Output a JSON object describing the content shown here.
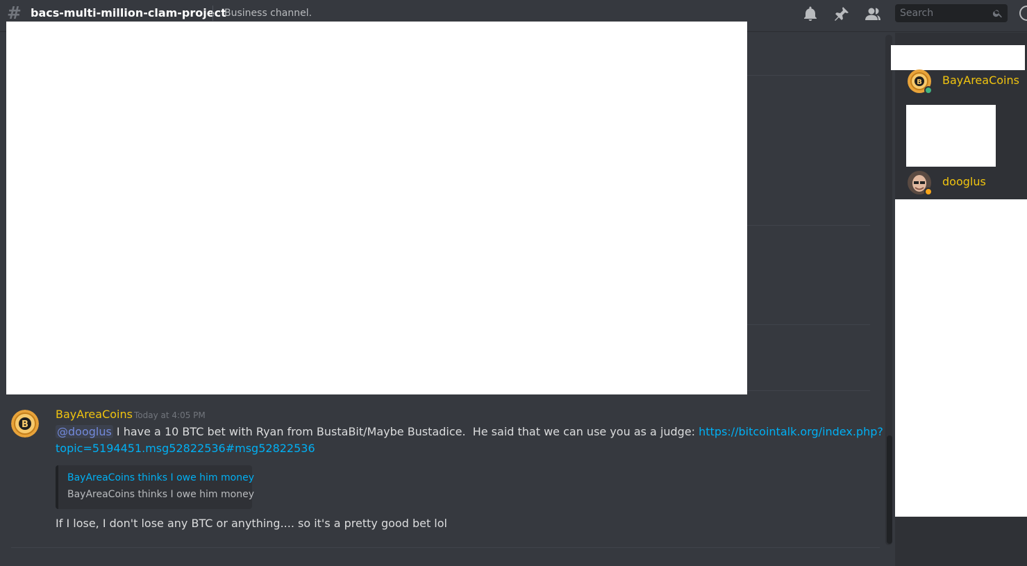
{
  "header": {
    "channel_name": "bacs-multi-million-clam-project",
    "topic": "Business channel.",
    "search_placeholder": "Search",
    "icons": [
      "hash-icon",
      "bell-icon",
      "pin-icon",
      "members-icon",
      "search-icon",
      "help-icon"
    ]
  },
  "message": {
    "author": "BayAreaCoins",
    "timestamp": "Today at 4:05 PM",
    "mention": "@dooglus",
    "text_part1": " I have a 10 BTC bet with Ryan from BustaBit/Maybe Bustadice.  He said that we can use you as a judge: ",
    "link_line1": "https://bitcointalk.org/index.php?",
    "link_line2": "topic=5194451.msg52822536#msg52822536",
    "embed": {
      "title": "BayAreaCoins thinks I owe him money",
      "description": "BayAreaCoins thinks I owe him money"
    },
    "followup": "If I lose, I don't lose any BTC or anything.... so it's a pretty good bet lol"
  },
  "members": [
    {
      "name": "BayAreaCoins",
      "status": "online",
      "status_color": "#43b581"
    },
    {
      "name": "dooglus",
      "status": "idle",
      "status_color": "#faa61a"
    }
  ],
  "colors": {
    "role_color": "#f1c40f",
    "link_color": "#00b0f4",
    "mention_color": "#7289da"
  }
}
